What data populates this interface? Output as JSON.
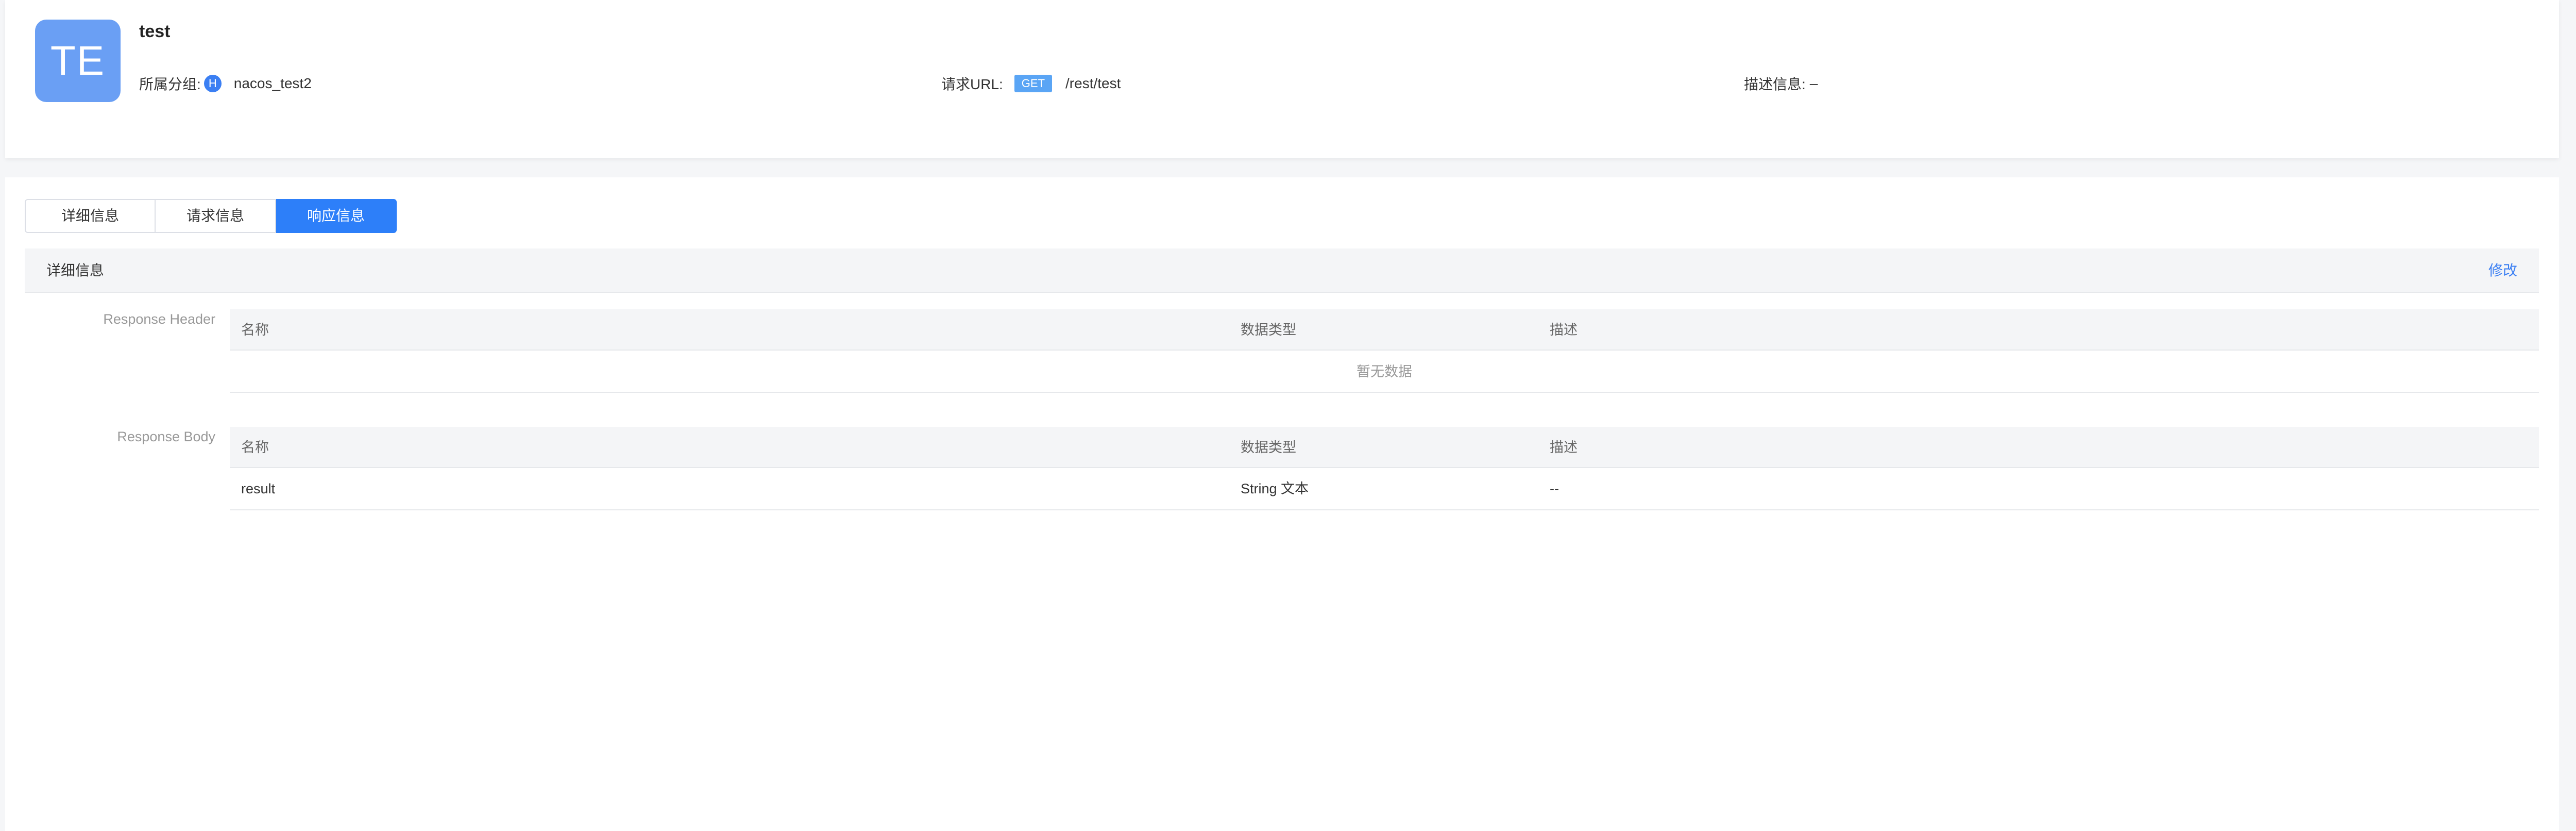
{
  "api": {
    "avatar_text": "TE",
    "name": "test",
    "group_label": "所属分组:",
    "group_badge": "H",
    "group_name": "nacos_test2",
    "url_label": "请求URL:",
    "method": "GET",
    "path": "/rest/test",
    "desc_label": "描述信息:",
    "desc_value": "–"
  },
  "tabs": [
    {
      "label": "详细信息",
      "active": false
    },
    {
      "label": "请求信息",
      "active": false
    },
    {
      "label": "响应信息",
      "active": true
    }
  ],
  "section": {
    "title": "详细信息",
    "edit_label": "修改"
  },
  "response_header": {
    "label": "Response Header",
    "columns": [
      "名称",
      "数据类型",
      "描述"
    ],
    "empty_text": "暂无数据"
  },
  "response_body": {
    "label": "Response Body",
    "columns": [
      "名称",
      "数据类型",
      "描述"
    ],
    "rows": [
      {
        "name": "result",
        "type": "String 文本",
        "desc": "--"
      }
    ]
  },
  "colors": {
    "accent": "#2d7ff9",
    "avatar": "#6a9ff4",
    "method_badge": "#5aa5f5"
  }
}
